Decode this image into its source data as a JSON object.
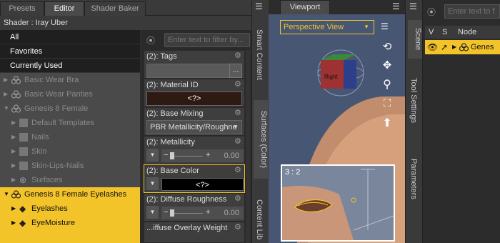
{
  "tabs": [
    "Presets",
    "Editor",
    "Shader Baker"
  ],
  "shader_label": "Shader : Iray Uber",
  "categories": [
    "All",
    "Favorites",
    "Currently Used"
  ],
  "tree": [
    {
      "label": "Basic Wear Bra",
      "state": "dim"
    },
    {
      "label": "Basic Wear Panties",
      "state": "dim"
    },
    {
      "label": "Genesis 8 Female",
      "state": "dim"
    },
    {
      "label": "Default Templates",
      "state": "dim"
    },
    {
      "label": "Nails",
      "state": "dim"
    },
    {
      "label": "Skin",
      "state": "dim"
    },
    {
      "label": "Skin-Lips-Nails",
      "state": "dim"
    },
    {
      "label": "Surfaces",
      "state": "dim"
    },
    {
      "label": "Genesis 8 Female Eyelashes",
      "state": "selected"
    },
    {
      "label": "Eyelashes",
      "state": "selected"
    },
    {
      "label": "EyeMoisture",
      "state": "selected"
    }
  ],
  "filter_placeholder": "Enter text to filter by...",
  "props": {
    "tags": "(2): Tags",
    "tags_btn": "...",
    "material_id": "(2): Material ID",
    "material_val": "<?>",
    "base_mixing": "(2): Base Mixing",
    "base_mixing_val": "PBR Metallicity/Roughne",
    "metallicity": "(2): Metallicity",
    "metallicity_val": "0.00",
    "base_color": "(2): Base Color",
    "base_color_val": "<?>",
    "diffuse_roughness": "(2): Diffuse Roughness",
    "diffuse_roughness_val": "0.00",
    "overlay_weight": "...iffuse Overlay Weight"
  },
  "side_tabs": [
    "Smart Content",
    "Surfaces (Color)",
    "Content Lib"
  ],
  "viewport": {
    "tab": "Viewport",
    "view": "Perspective View",
    "cube_label": "Right",
    "inset_label": "3 : 2"
  },
  "right_tabs": [
    "Scene",
    "Tool Settings",
    "Parameters"
  ],
  "scene": {
    "filter_placeholder": "Enter text to f",
    "col_v": "V",
    "col_s": "S",
    "col_node": "Node",
    "node": "Genes"
  },
  "colors": {
    "selection": "#f3c42a",
    "viewport_bg": "#475673"
  }
}
